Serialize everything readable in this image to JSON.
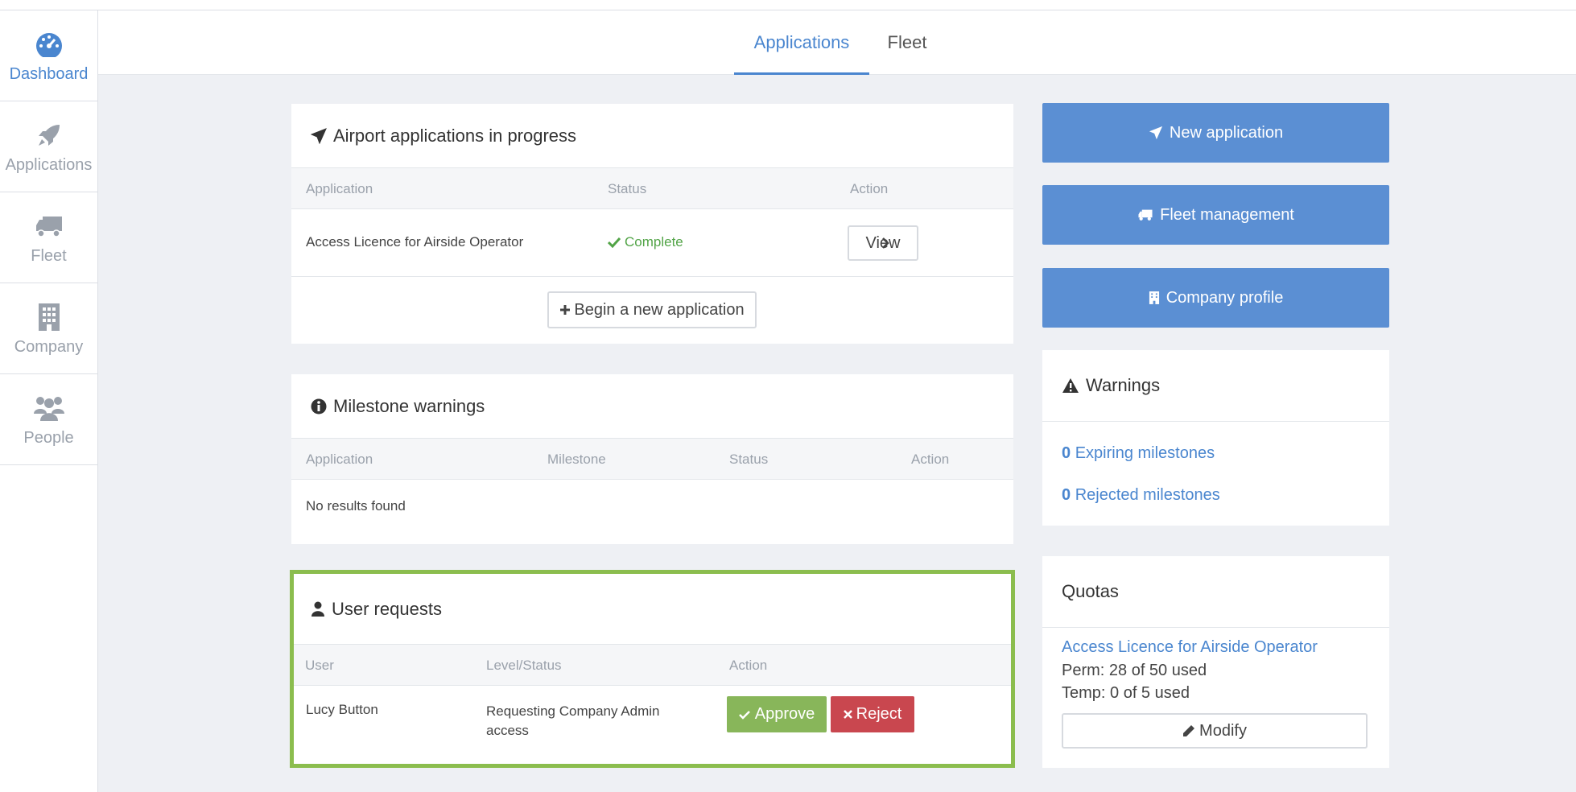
{
  "sidebar": {
    "items": [
      {
        "label": "Dashboard",
        "icon": "dashboard-icon",
        "active": true
      },
      {
        "label": "Applications",
        "icon": "rocket-icon"
      },
      {
        "label": "Fleet",
        "icon": "truck-icon"
      },
      {
        "label": "Company",
        "icon": "building-icon"
      },
      {
        "label": "People",
        "icon": "users-icon"
      }
    ]
  },
  "tabs": [
    {
      "label": "Applications",
      "active": true
    },
    {
      "label": "Fleet"
    }
  ],
  "applications_panel": {
    "title": "Airport applications in progress",
    "columns": [
      "Application",
      "Status",
      "Action"
    ],
    "rows": [
      {
        "application": "Access Licence for Airside Operator",
        "status": "Complete",
        "action": "View"
      }
    ],
    "new_button": "Begin a new application"
  },
  "milestone_panel": {
    "title": "Milestone warnings",
    "columns": [
      "Application",
      "Milestone",
      "Status",
      "Action"
    ],
    "empty_text": "No results found"
  },
  "user_requests_panel": {
    "title": "User requests",
    "columns": [
      "User",
      "Level/Status",
      "Action"
    ],
    "rows": [
      {
        "user": "Lucy Button",
        "level_line1": "Requesting Company Admin",
        "level_line2": "access",
        "approve": "Approve",
        "reject": "Reject"
      }
    ],
    "highlight_color": "#8bbd4e"
  },
  "actions": {
    "new_application": "New application",
    "fleet_management": "Fleet management",
    "company_profile": "Company profile"
  },
  "warnings_panel": {
    "title": "Warnings",
    "expiring_count": "0",
    "expiring_label": "Expiring milestones",
    "rejected_count": "0",
    "rejected_label": "Rejected milestones"
  },
  "quotas_panel": {
    "title": "Quotas",
    "licence": "Access Licence for Airside Operator",
    "perm": "Perm: 28 of 50 used",
    "temp": "Temp: 0 of 5 used",
    "modify": "Modify"
  },
  "colors": {
    "accent": "#4a86cf",
    "button_blue": "#5b8fd3",
    "approve": "#88b65a",
    "reject": "#c9474f",
    "complete": "#52a447"
  }
}
